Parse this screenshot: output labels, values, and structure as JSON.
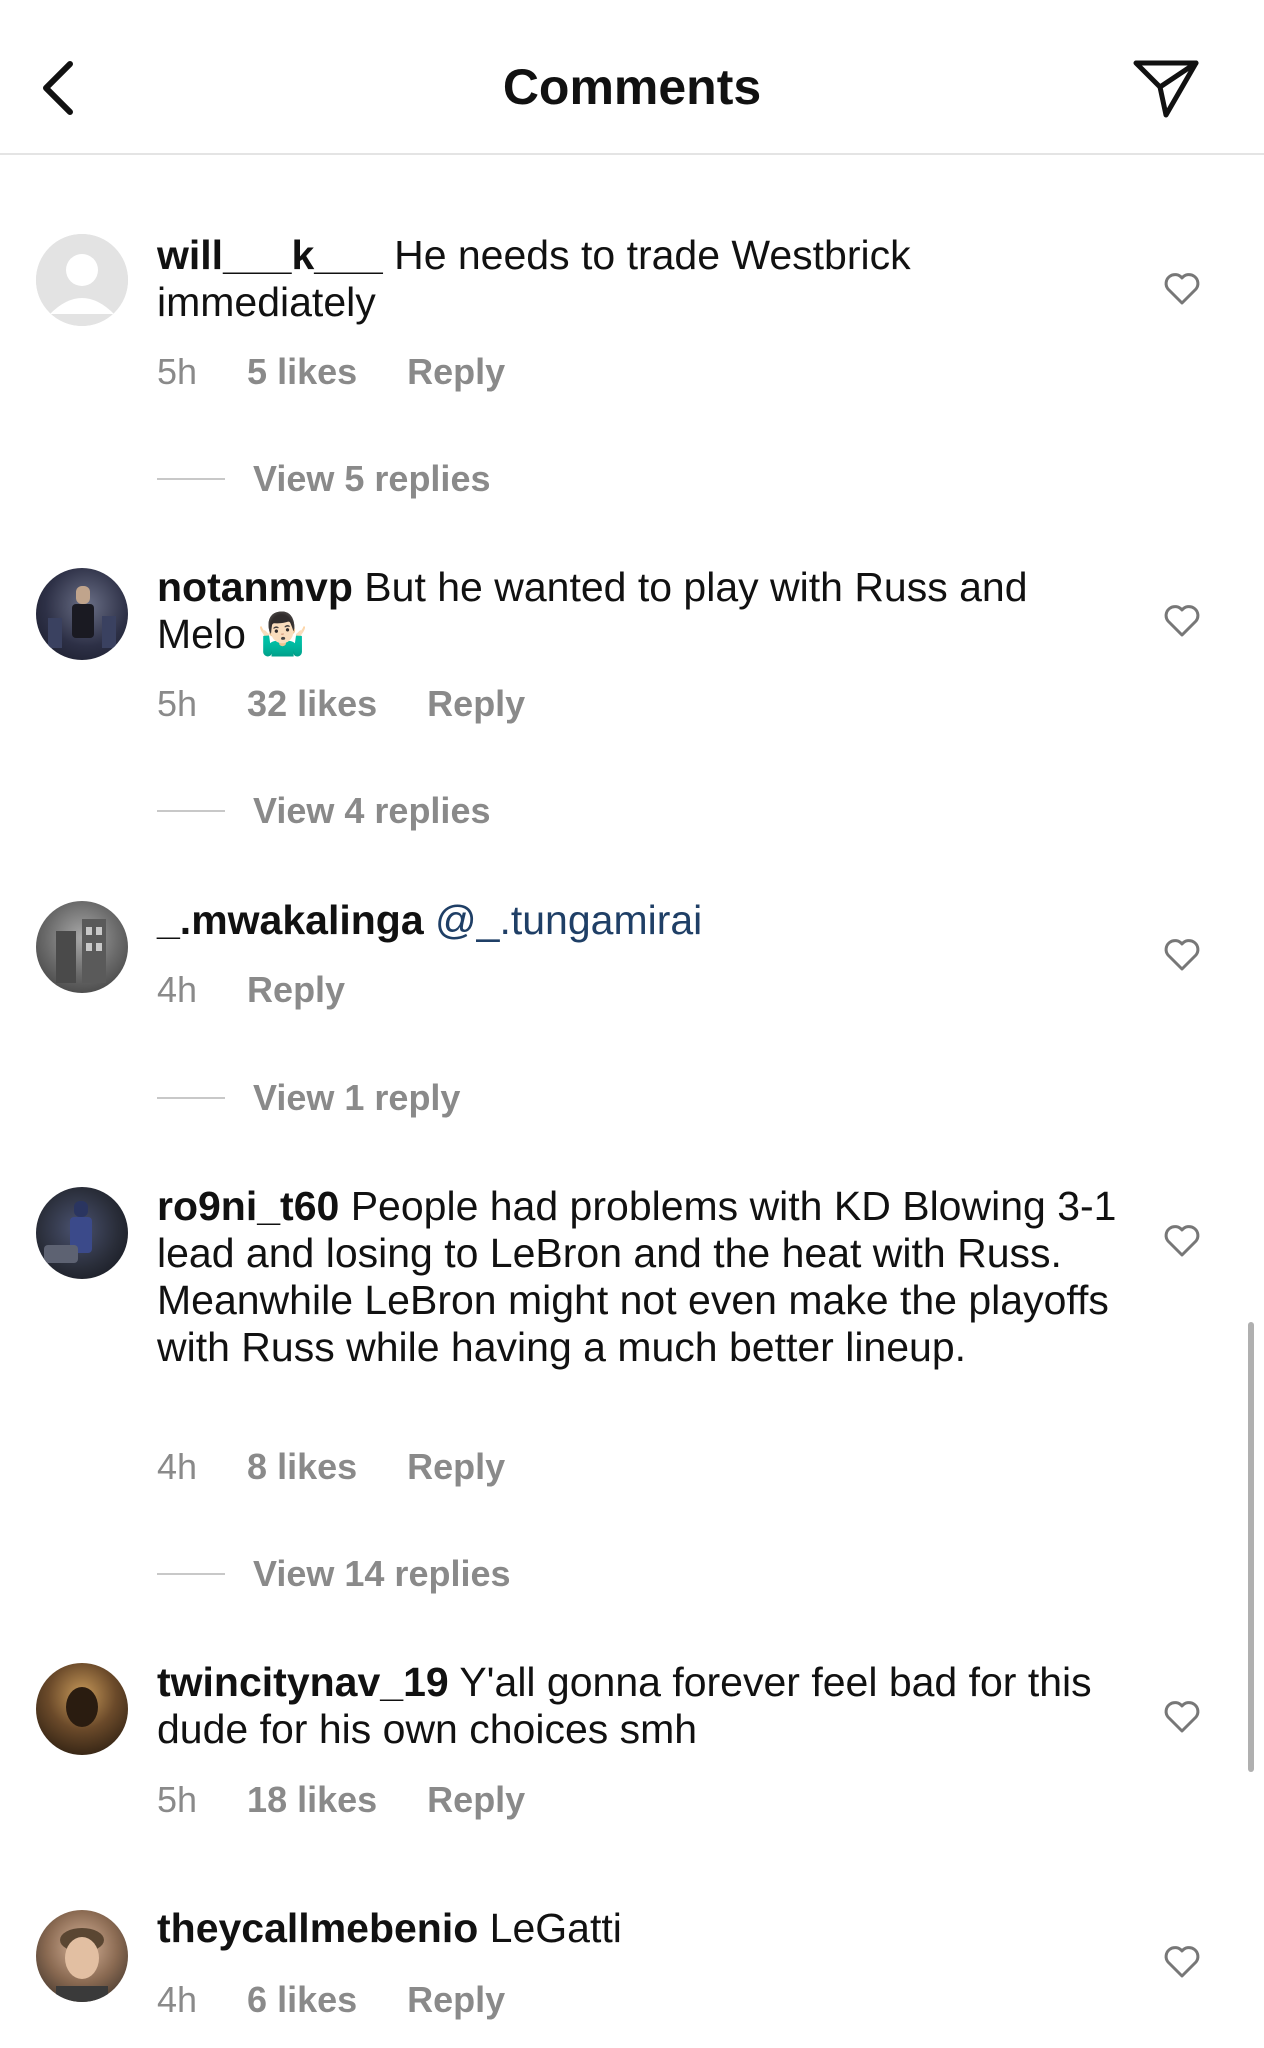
{
  "header": {
    "title": "Comments"
  },
  "comments": [
    {
      "username": "will___k___",
      "text": " He needs to trade Westbrick immediately",
      "time": "5h",
      "likes": "5 likes",
      "reply": "Reply",
      "view_replies": "View 5 replies"
    },
    {
      "username": "notanmvp",
      "text": " But he wanted to play with Russ and Melo ",
      "emoji": "🤷🏻‍♂️",
      "time": "5h",
      "likes": "32 likes",
      "reply": "Reply",
      "view_replies": "View 4 replies"
    },
    {
      "username": "_.mwakalinga",
      "mention": "@_.tungamirai",
      "time": "4h",
      "reply": "Reply",
      "view_replies": "View 1 reply"
    },
    {
      "username": "ro9ni_t60",
      "text": " People had problems with KD Blowing 3-1 lead  and losing to LeBron and the heat with Russ. Meanwhile LeBron might not even make the playoffs with Russ while having a much better lineup.",
      "time": "4h",
      "likes": "8 likes",
      "reply": "Reply",
      "view_replies": "View 14 replies"
    },
    {
      "username": "twincitynav_19",
      "text": " Y'all gonna forever feel bad for this dude for his own choices smh",
      "time": "5h",
      "likes": "18 likes",
      "reply": "Reply"
    },
    {
      "username": "theycallmebenio",
      "text": " LeGatti",
      "time": "4h",
      "likes": "6 likes",
      "reply": "Reply"
    }
  ],
  "colors": {
    "text": "#111111",
    "meta": "#8a8a8a",
    "mention": "#1f3f66",
    "divider": "#e4e4e4"
  },
  "icons": {
    "back": "chevron-left-icon",
    "send": "paper-plane-icon",
    "like": "heart-outline-icon"
  }
}
